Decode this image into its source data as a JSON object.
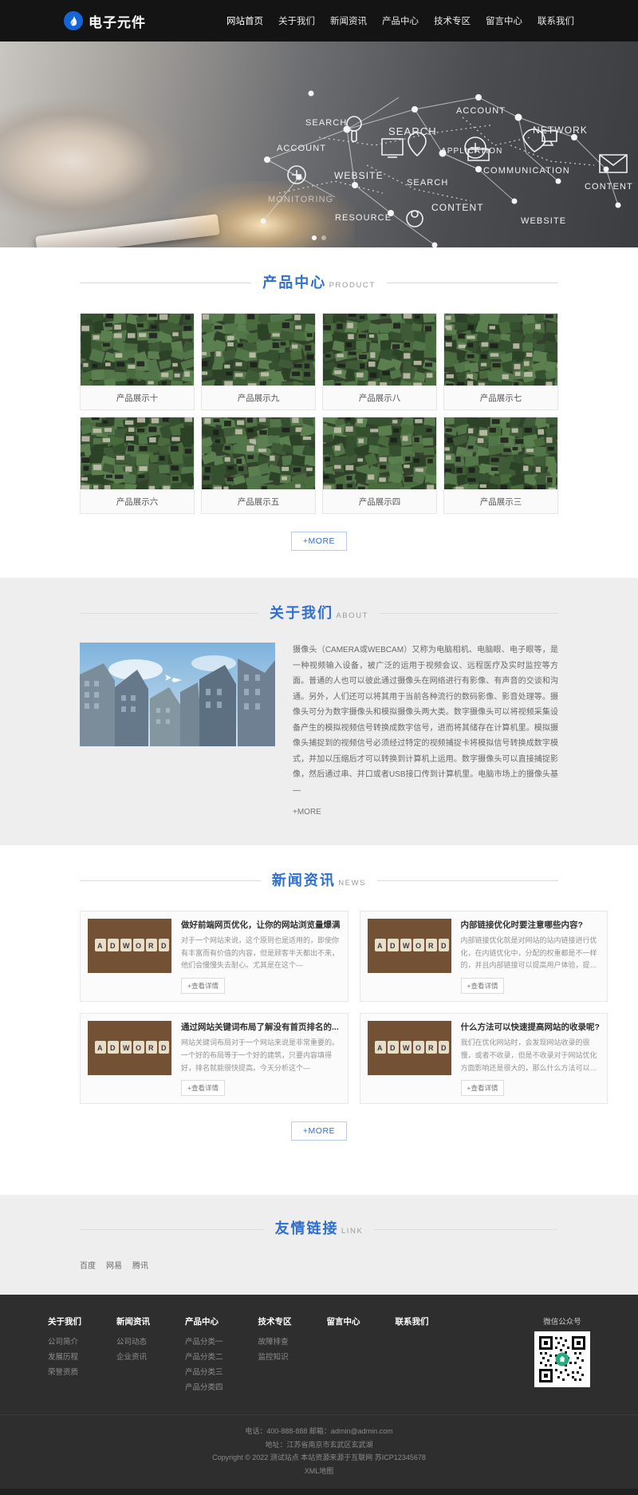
{
  "header": {
    "brand": "电子元件",
    "logo_color": "#1565d8",
    "nav": [
      {
        "label": "网站首页",
        "active": true
      },
      {
        "label": "关于我们",
        "active": false
      },
      {
        "label": "新闻资讯",
        "active": false
      },
      {
        "label": "产品中心",
        "active": false
      },
      {
        "label": "技术专区",
        "active": false
      },
      {
        "label": "留言中心",
        "active": false
      },
      {
        "label": "联系我们",
        "active": false
      }
    ]
  },
  "hero": {
    "node_labels": [
      "SEARCH",
      "ACCOUNT",
      "SEARCH",
      "ACCOUNT",
      "NETWORK",
      "APPLICATION",
      "WEBSITE",
      "COMMUNICATION",
      "CONTENT",
      "SEARCH",
      "MONITORING",
      "RESOURCE",
      "CONTENT",
      "WEBSITE"
    ],
    "slides": 2,
    "active_slide": 1
  },
  "products": {
    "title_cn": "产品中心",
    "title_en": "PRODUCT",
    "more_label": "+MORE",
    "items": [
      {
        "caption": "产品展示十"
      },
      {
        "caption": "产品展示九"
      },
      {
        "caption": "产品展示八"
      },
      {
        "caption": "产品展示七"
      },
      {
        "caption": "产品展示六"
      },
      {
        "caption": "产品展示五"
      },
      {
        "caption": "产品展示四"
      },
      {
        "caption": "产品展示三"
      }
    ]
  },
  "about": {
    "title_cn": "关于我们",
    "title_en": "ABOUT",
    "body": "摄像头（CAMERA或WEBCAM）又称为电脑相机、电脑眼、电子眼等，是一种视频输入设备，被广泛的运用于视频会议、远程医疗及实时监控等方面。普通的人也可以彼此通过摄像头在网络进行有影像、有声音的交谈和沟通。另外，人们还可以将其用于当前各种流行的数码影像、影音处理等。摄像头可分为数字摄像头和模拟摄像头两大类。数字摄像头可以将视频采集设备产生的模拟视频信号转换成数字信号，进而将其储存在计算机里。模拟摄像头捕捉到的视频信号必须经过特定的视频捕捉卡将模拟信号转换成数字模式，并加以压缩后才可以转换到计算机上运用。数字摄像头可以直接捕捉影像，然后通过串、并口或者USB接口传到计算机里。电脑市场上的摄像头基—",
    "more_label": "+MORE"
  },
  "news": {
    "title_cn": "新闻资讯",
    "title_en": "NEWS",
    "more_label": "+MORE",
    "detail_label": "+查看详情",
    "items": [
      {
        "title": "做好前端网页优化，让你的网站浏览量爆满",
        "desc": "对于一个网站来说，这个原则也是适用的，即使你有丰富而有价值的内容，但是顾客半天都出不来，他们会慢慢失去耐心。尤其是在这个—"
      },
      {
        "title": "内部链接优化时要注意哪些内容?",
        "desc": "内部链接优化就是对网站的站内链接进行优化，在内链优化中，分配的权重都是不一样的，并且内部链接可以提高用户体验，提升访问—"
      },
      {
        "title": "通过网站关键词布局了解没有首页排名的...",
        "desc": "网站关键词布局对于一个网站来说是非常重要的。一个好的布局等于一个好的建筑，只要内容填得好，排名就能很快提高。今天分析这个—"
      },
      {
        "title": "什么方法可以快速提高网站的收录呢?",
        "desc": "我们在优化网站时，会发现网站收录的很慢，或者不收录，但是不收录对于网站优化方面影响还是很大的，那么什么方法可以快速提高网—"
      }
    ]
  },
  "links": {
    "title_cn": "友情链接",
    "title_en": "LINK",
    "items": [
      {
        "label": "百度"
      },
      {
        "label": "网易"
      },
      {
        "label": "腾讯"
      }
    ]
  },
  "footer": {
    "columns": [
      {
        "title": "关于我们",
        "items": [
          {
            "label": "公司简介"
          },
          {
            "label": "发展历程"
          },
          {
            "label": "荣誉资质"
          }
        ]
      },
      {
        "title": "新闻资讯",
        "items": [
          {
            "label": "公司动态"
          },
          {
            "label": "企业资讯"
          }
        ]
      },
      {
        "title": "产品中心",
        "items": [
          {
            "label": "产品分类一"
          },
          {
            "label": "产品分类二"
          },
          {
            "label": "产品分类三"
          },
          {
            "label": "产品分类四"
          }
        ]
      },
      {
        "title": "技术专区",
        "items": [
          {
            "label": "故障排查"
          },
          {
            "label": "监控知识"
          }
        ]
      },
      {
        "title": "留言中心",
        "items": []
      },
      {
        "title": "联系我们",
        "items": []
      }
    ],
    "qr_caption": "微信公众号",
    "contact_line": "电话：400-888-888 邮箱：admin@admin.com",
    "address_line": "地址：江苏省南京市玄武区玄武湖",
    "copyright_line": "Copyright © 2022 测试站点 本站资源来源于互联网 苏ICP12345678",
    "sitemap_label": "XML地图"
  }
}
